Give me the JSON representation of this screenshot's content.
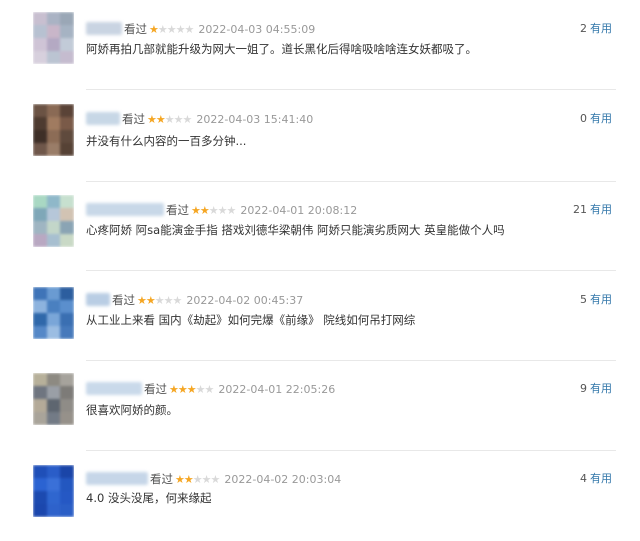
{
  "comments": [
    {
      "watched": "看过",
      "rating": 1,
      "time": "2022-04-03 04:55:09",
      "content": "阿娇再拍几部就能升级为网大一姐了。道长黑化后得啥吸啥啥连女妖都吸了。",
      "votes": "2",
      "useful_label": "有用"
    },
    {
      "watched": "看过",
      "rating": 2,
      "time": "2022-04-03 15:41:40",
      "content": "并没有什么内容的一百多分钟...",
      "votes": "0",
      "useful_label": "有用"
    },
    {
      "watched": "看过",
      "rating": 2,
      "time": "2022-04-01 20:08:12",
      "content": "心疼阿娇 阿sa能演金手指 搭戏刘德华梁朝伟 阿娇只能演劣质网大 英皇能做个人吗",
      "votes": "21",
      "useful_label": "有用"
    },
    {
      "watched": "看过",
      "rating": 2,
      "time": "2022-04-02 00:45:37",
      "content": "从工业上来看 国内《劫起》如何完爆《前缘》 院线如何吊打网综",
      "votes": "5",
      "useful_label": "有用"
    },
    {
      "watched": "看过",
      "rating": 3,
      "time": "2022-04-01 22:05:26",
      "content": "很喜欢阿娇的颜。",
      "votes": "9",
      "useful_label": "有用"
    },
    {
      "watched": "看过",
      "rating": 2,
      "time": "2022-04-02 20:03:04",
      "content": "4.0 没头没尾，何来缘起",
      "votes": "4",
      "useful_label": "有用"
    }
  ],
  "colors": {
    "star_on": "#f5a623",
    "star_off": "#d9d9d9",
    "useful_link": "#3377aa",
    "time_text": "#999999",
    "divider": "#e8e8e8"
  }
}
